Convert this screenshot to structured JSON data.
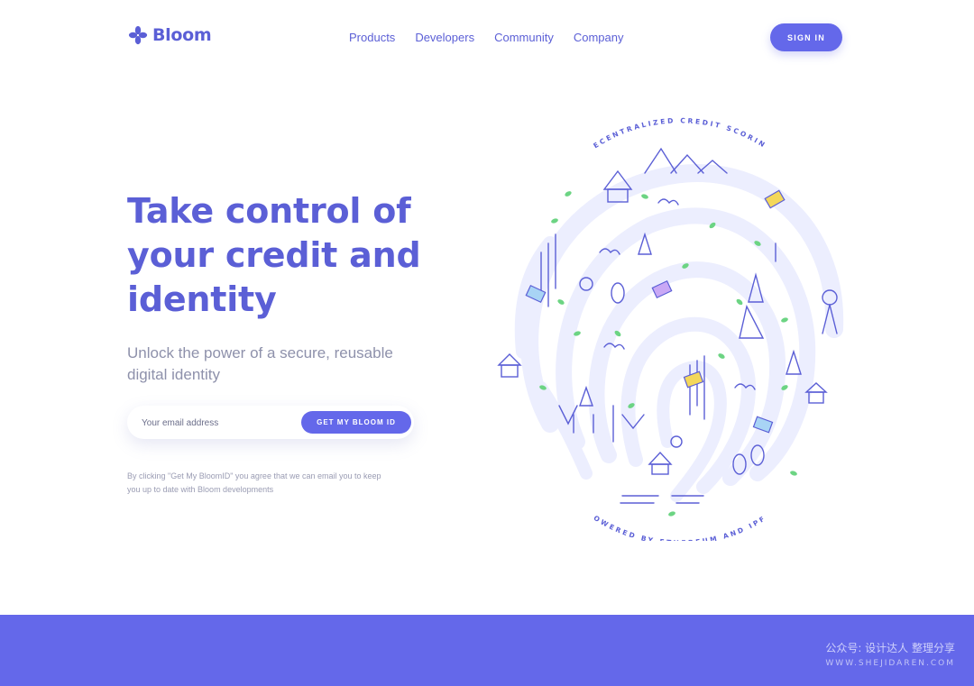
{
  "header": {
    "brand": "Bloom",
    "nav": [
      {
        "label": "Products"
      },
      {
        "label": "Developers"
      },
      {
        "label": "Community"
      },
      {
        "label": "Company"
      }
    ],
    "signin_label": "SIGN IN"
  },
  "hero": {
    "title_lines": [
      "Take control of",
      "your credit and",
      "identity"
    ],
    "subtitle_lines": [
      "Unlock the power of a secure, reusable",
      "digital identity"
    ],
    "email_placeholder": "Your email address",
    "cta_label": "GET MY BLOOM ID",
    "disclaimer_lines": [
      "By clicking \"Get My BloomID\" you agree that we can email you to keep",
      "you up to date with Bloom developments"
    ]
  },
  "illustration": {
    "top_caption": "DECENTRALIZED CREDIT SCORING",
    "bottom_caption": "POWERED BY ETHEREUM AND IPFS"
  },
  "watermark": {
    "chinese_text": "公众号: 设计达人 整理分享",
    "url": "WWW.SHEJIDAREN.COM"
  },
  "colors": {
    "brand": "#5b5fd6",
    "button": "#6468ea",
    "green_accent": "#6cd483",
    "yellow_accent": "#f3d75a",
    "muted_text": "#8e91ab",
    "footer_band": "#6468ea"
  },
  "icons": [
    "bloom-logo-icon",
    "fingerprint-illustration"
  ]
}
